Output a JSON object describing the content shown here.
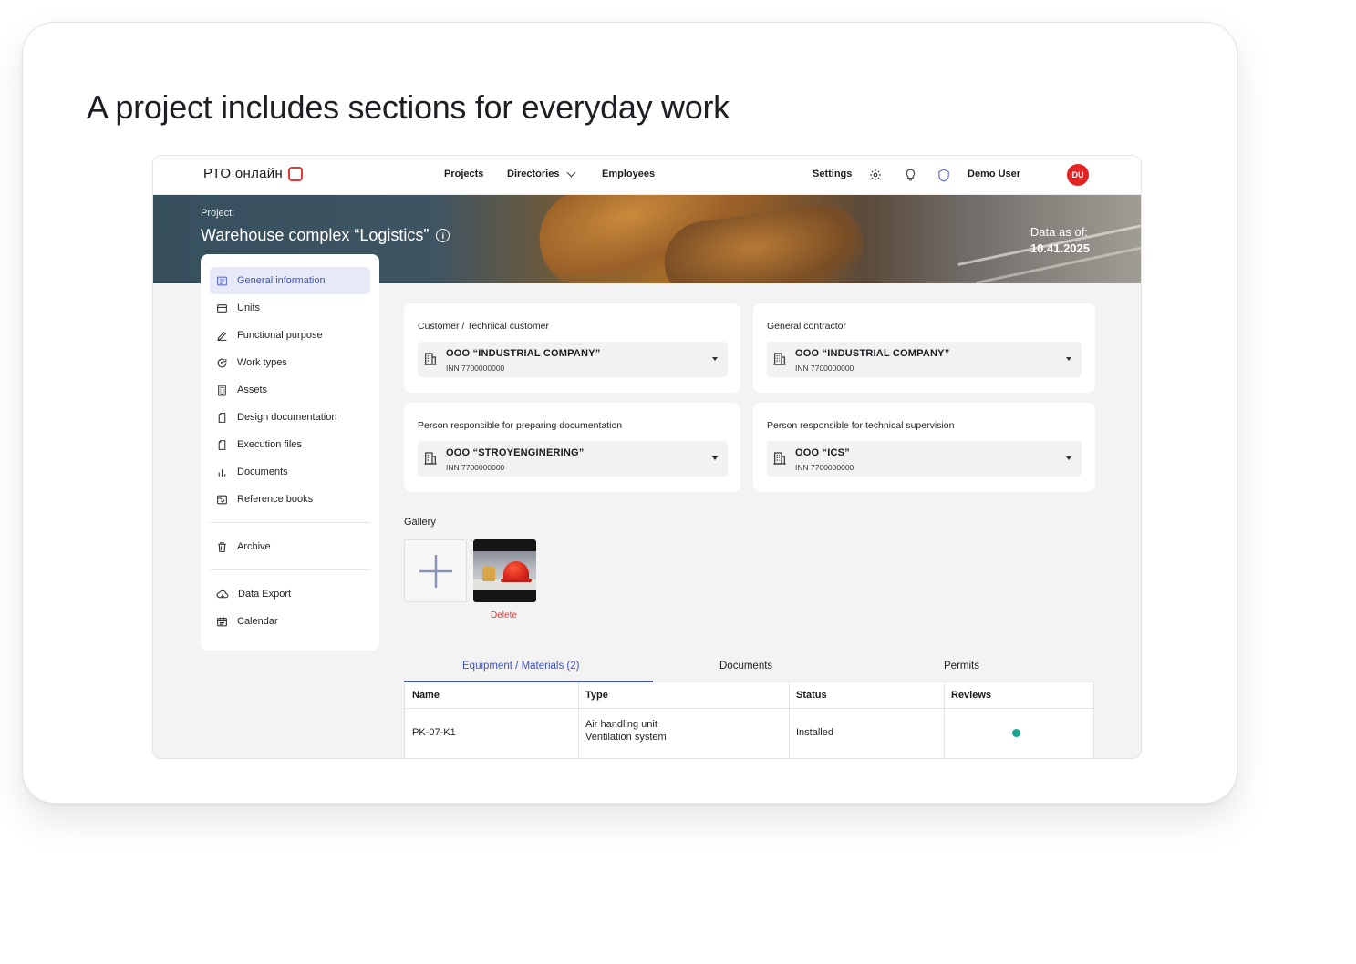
{
  "headline": "A project includes sections for everyday work",
  "topnav": {
    "logo": "РТО онлайн",
    "links": [
      "Projects",
      "Directories",
      "Employees"
    ],
    "settings": "Settings",
    "user_name": "Demo User",
    "avatar_initials": "DU"
  },
  "banner": {
    "project_label": "Project:",
    "project_title": "Warehouse complex “Logistics”",
    "data_as_of_label": "Data as of:",
    "data_as_of_date": "10.41.2025"
  },
  "sidebar": {
    "items": [
      {
        "label": "General information",
        "icon": "list-icon"
      },
      {
        "label": "Units",
        "icon": "folder-icon"
      },
      {
        "label": "Functional purpose",
        "icon": "pencil-icon"
      },
      {
        "label": "Work types",
        "icon": "refresh-icon"
      },
      {
        "label": "Assets",
        "icon": "calculator-icon"
      },
      {
        "label": "Design documentation",
        "icon": "file-icon"
      },
      {
        "label": "Execution files",
        "icon": "file-icon"
      },
      {
        "label": "Documents",
        "icon": "bar-chart-icon"
      },
      {
        "label": "Reference books",
        "icon": "book-icon"
      }
    ],
    "archive": "Archive",
    "bottom": [
      {
        "label": "Data Export",
        "icon": "cloud-icon"
      },
      {
        "label": "Calendar",
        "icon": "calendar-icon"
      }
    ]
  },
  "cards": [
    {
      "label": "Customer / Technical customer",
      "name": "OOO “INDUSTRIAL COMPANY”",
      "inn": "INN 7700000000"
    },
    {
      "label": "General contractor",
      "name": "OOO “INDUSTRIAL COMPANY”",
      "inn": "INN 7700000000"
    },
    {
      "label": "Person responsible for preparing documentation",
      "name": "OOO “STROYENGINERING”",
      "inn": "INN 7700000000"
    },
    {
      "label": "Person responsible for technical supervision",
      "name": "OOO “ICS”",
      "inn": "INN 7700000000"
    }
  ],
  "gallery": {
    "label": "Gallery",
    "delete": "Delete"
  },
  "tabs": [
    "Equipment / Materials (2)",
    "Documents",
    "Permits"
  ],
  "table": {
    "headers": [
      "Name",
      "Type",
      "Status",
      "Reviews"
    ],
    "rows": [
      {
        "name": "PK-07-K1",
        "type_line1": "Air handling unit",
        "type_line2": "Ventilation system",
        "status": "Installed"
      }
    ]
  },
  "colors": {
    "accent": "#3d52c9",
    "brand_red": "#e53935",
    "status_ok": "#18a594"
  }
}
